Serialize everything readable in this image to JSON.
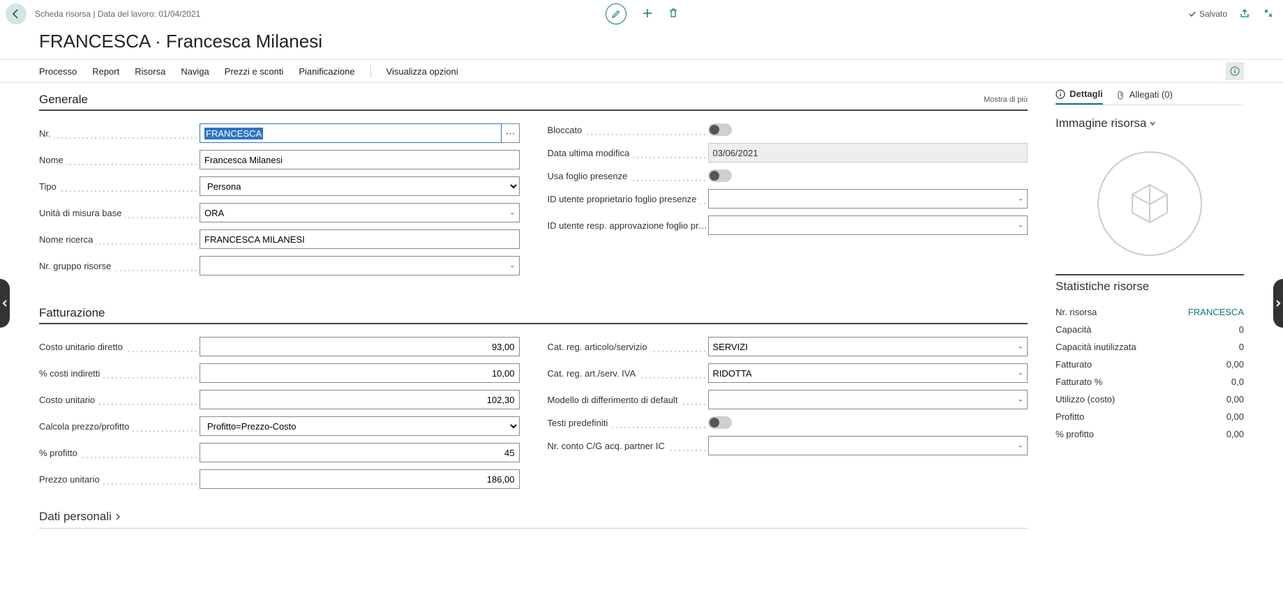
{
  "breadcrumb": "Scheda risorsa | Data del lavoro: 01/04/2021",
  "saved_label": "Salvato",
  "page_title": "FRANCESCA · Francesca Milanesi",
  "nav": {
    "processo": "Processo",
    "report": "Report",
    "risorsa": "Risorsa",
    "naviga": "Naviga",
    "prezzi": "Prezzi e sconti",
    "pianificazione": "Pianificazione",
    "visualizza": "Visualizza opzioni"
  },
  "sections": {
    "generale": "Generale",
    "fatturazione": "Fatturazione",
    "dati_personali": "Dati personali",
    "mostra_di_piu": "Mostra di più"
  },
  "generale": {
    "nr_label": "Nr.",
    "nr_value": "FRANCESCA",
    "nome_label": "Nome",
    "nome_value": "Francesca Milanesi",
    "tipo_label": "Tipo",
    "tipo_value": "Persona",
    "um_label": "Unità di misura base",
    "um_value": "ORA",
    "nome_ricerca_label": "Nome ricerca",
    "nome_ricerca_value": "FRANCESCA MILANESI",
    "gruppo_label": "Nr. gruppo risorse",
    "gruppo_value": "",
    "bloccato_label": "Bloccato",
    "data_mod_label": "Data ultima modifica",
    "data_mod_value": "03/06/2021",
    "foglio_label": "Usa foglio presenze",
    "id_prop_label": "ID utente proprietario foglio presenze",
    "id_prop_value": "",
    "id_resp_label": "ID utente resp. approvazione foglio pr...",
    "id_resp_value": ""
  },
  "fatturazione": {
    "costo_diretto_label": "Costo unitario diretto",
    "costo_diretto_value": "93,00",
    "costi_ind_label": "% costi indiretti",
    "costi_ind_value": "10,00",
    "costo_unit_label": "Costo unitario",
    "costo_unit_value": "102,30",
    "calc_label": "Calcola prezzo/profitto",
    "calc_value": "Profitto=Prezzo-Costo",
    "profitto_label": "% profitto",
    "profitto_value": "45",
    "prezzo_label": "Prezzo unitario",
    "prezzo_value": "186,00",
    "cat_serv_label": "Cat. reg. articolo/servizio",
    "cat_serv_value": "SERVIZI",
    "cat_iva_label": "Cat. reg. art./serv. IVA",
    "cat_iva_value": "RIDOTTA",
    "diff_label": "Modello di differimento di default",
    "diff_value": "",
    "testi_label": "Testi predefiniti",
    "conto_label": "Nr. conto C/G acq. partner IC",
    "conto_value": ""
  },
  "side": {
    "tab_dettagli": "Dettagli",
    "tab_allegati": "Allegati (0)",
    "immagine_title": "Immagine risorsa",
    "stat_title": "Statistiche risorse",
    "stat_nr_label": "Nr. risorsa",
    "stat_nr_value": "FRANCESCA",
    "capacita_label": "Capacità",
    "capacita_value": "0",
    "cap_inut_label": "Capacità inutilizzata",
    "cap_inut_value": "0",
    "fatturato_label": "Fatturato",
    "fatturato_value": "0,00",
    "fatturato_pct_label": "Fatturato %",
    "fatturato_pct_value": "0,0",
    "utilizzo_label": "Utilizzo (costo)",
    "utilizzo_value": "0,00",
    "profitto_label": "Profitto",
    "profitto_value": "0,00",
    "profitto_pct_label": "% profitto",
    "profitto_pct_value": "0,00"
  }
}
